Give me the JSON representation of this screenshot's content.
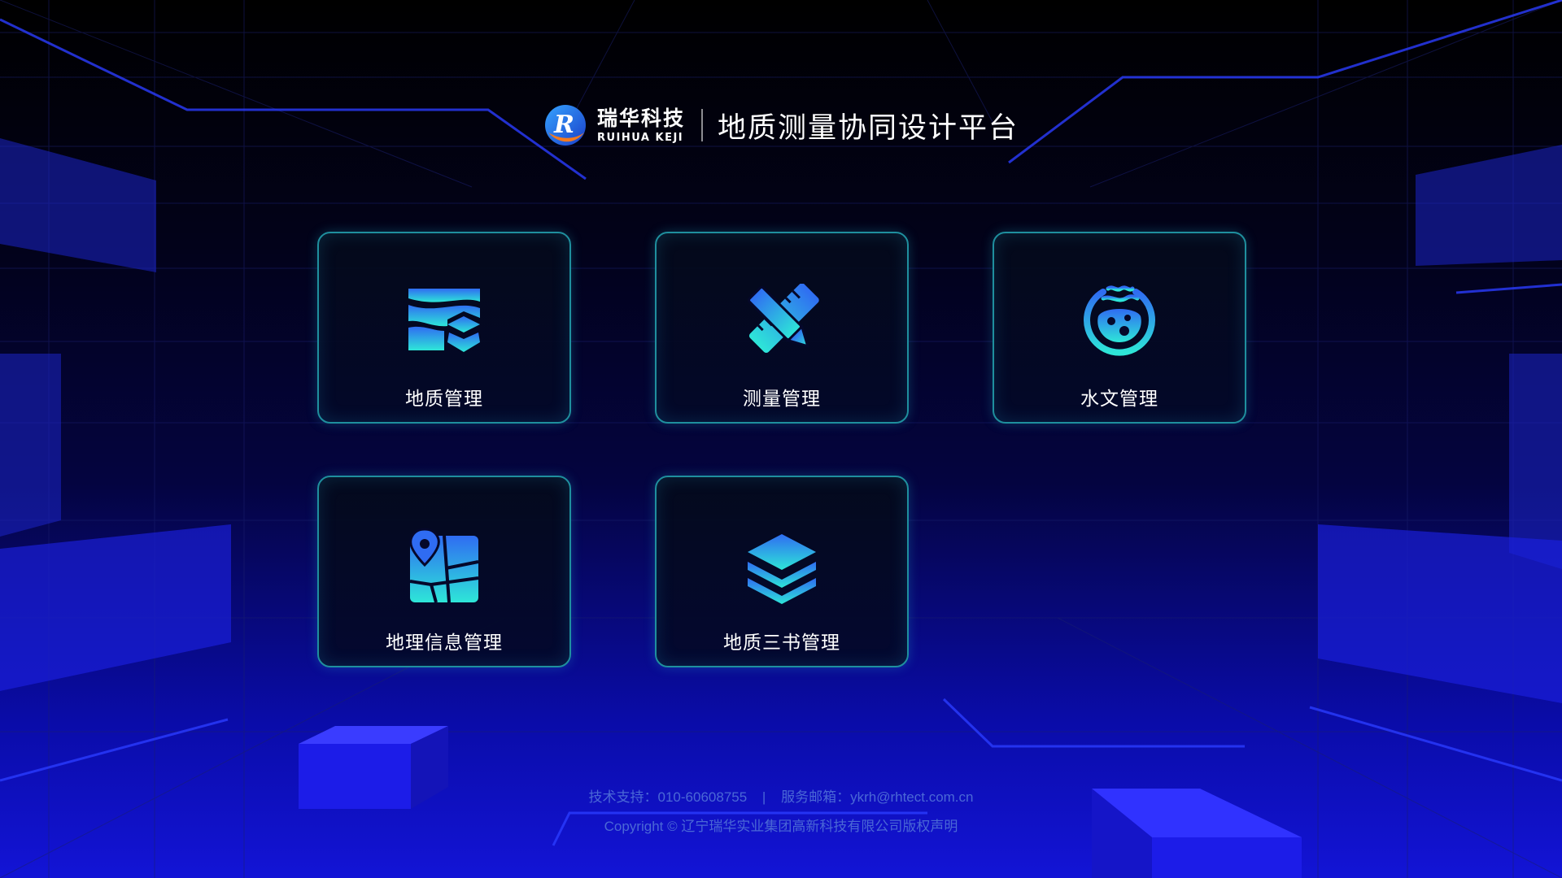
{
  "brand": {
    "logo_cn": "瑞华科技",
    "logo_en": "RUIHUA KEJI",
    "platform_title": "地质测量协同设计平台"
  },
  "modules": [
    {
      "label": "地质管理",
      "icon": "geology-layers-icon"
    },
    {
      "label": "测量管理",
      "icon": "pencil-ruler-icon"
    },
    {
      "label": "水文管理",
      "icon": "water-flask-icon"
    },
    {
      "label": "地理信息管理",
      "icon": "map-pin-icon"
    },
    {
      "label": "地质三书管理",
      "icon": "stacked-layers-icon"
    }
  ],
  "footer": {
    "support": "技术支持：010-60608755",
    "separator": "|",
    "email": "服务邮箱：ykrh@rhtect.com.cn",
    "copyright": "Copyright © 辽宁瑞华实业集团高新科技有限公司版权声明"
  },
  "colors": {
    "card_border": "#1f8f9e",
    "icon_gradient_top": "#2f6cf2",
    "icon_gradient_bottom": "#2ee6d8",
    "footer_text": "#4a68d6"
  }
}
